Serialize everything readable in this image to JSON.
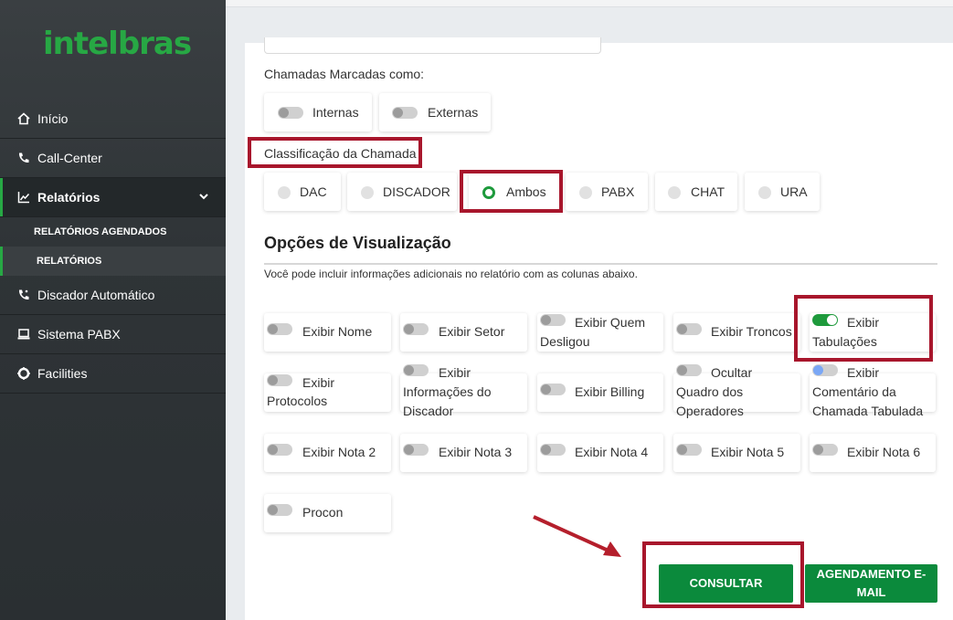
{
  "brand": {
    "logo_text": "intelbras",
    "accent": "#27a844"
  },
  "sidebar": {
    "items": [
      {
        "label": "Início",
        "icon": "home-icon"
      },
      {
        "label": "Call-Center",
        "icon": "phone-icon"
      },
      {
        "label": "Relatórios",
        "icon": "chart-icon"
      },
      {
        "label": "Discador Automático",
        "icon": "phone-dialer-icon"
      },
      {
        "label": "Sistema PABX",
        "icon": "monitor-icon"
      },
      {
        "label": "Facilities",
        "icon": "life-ring-icon"
      }
    ],
    "subitems": [
      {
        "label": "RELATÓRIOS AGENDADOS"
      },
      {
        "label": "RELATÓRIOS"
      }
    ]
  },
  "filters": {
    "calls_marked_label": "Chamadas Marcadas como:",
    "calls_marked_options": [
      {
        "label": "Internas",
        "on": false
      },
      {
        "label": "Externas",
        "on": false
      }
    ],
    "classification_label": "Classificação da Chamada",
    "classification_options": [
      {
        "label": "DAC",
        "selected": false
      },
      {
        "label": "DISCADOR",
        "selected": false
      },
      {
        "label": "Ambos",
        "selected": true
      },
      {
        "label": "PABX",
        "selected": false
      },
      {
        "label": "CHAT",
        "selected": false
      },
      {
        "label": "URA",
        "selected": false
      }
    ]
  },
  "view_options": {
    "title": "Opções de Visualização",
    "description": "Você pode incluir informações adicionais no relatório com as colunas abaixo.",
    "columns": [
      {
        "line1": "Exibir Nome",
        "line2": "",
        "line3": "",
        "on": false
      },
      {
        "line1": "Exibir Setor",
        "line2": "",
        "line3": "",
        "on": false
      },
      {
        "line1": "Exibir Quem",
        "line2": "Desligou",
        "line3": "",
        "on": false
      },
      {
        "line1": "Exibir Troncos",
        "line2": "",
        "line3": "",
        "on": false
      },
      {
        "line1": "Exibir",
        "line2": "Tabulações",
        "line3": "",
        "on": true
      },
      {
        "line1": "Exibir",
        "line2": "Protocolos",
        "line3": "",
        "on": false
      },
      {
        "line1": "Exibir",
        "line2": "Informações do",
        "line3": "Discador",
        "on": false
      },
      {
        "line1": "Exibir Billing",
        "line2": "",
        "line3": "",
        "on": false
      },
      {
        "line1": "Ocultar",
        "line2": "Quadro dos",
        "line3": "Operadores",
        "on": false
      },
      {
        "line1": "Exibir",
        "line2": "Comentário da",
        "line3": "Chamada Tabulada",
        "on": false
      },
      {
        "line1": "Exibir Nota 2",
        "line2": "",
        "line3": "",
        "on": false
      },
      {
        "line1": "Exibir Nota 3",
        "line2": "",
        "line3": "",
        "on": false
      },
      {
        "line1": "Exibir Nota 4",
        "line2": "",
        "line3": "",
        "on": false
      },
      {
        "line1": "Exibir Nota 5",
        "line2": "",
        "line3": "",
        "on": false
      },
      {
        "line1": "Exibir Nota 6",
        "line2": "",
        "line3": "",
        "on": false
      },
      {
        "line1": "Procon",
        "line2": "",
        "line3": "",
        "on": false
      }
    ]
  },
  "actions": {
    "consult_label": "CONSULTAR",
    "schedule_line1": "AGENDAMENTO E-",
    "schedule_line2": "MAIL"
  },
  "colors": {
    "highlight_box": "#a8162c",
    "primary_button": "#0b8a3c",
    "toggle_on": "#1e9a3c"
  }
}
